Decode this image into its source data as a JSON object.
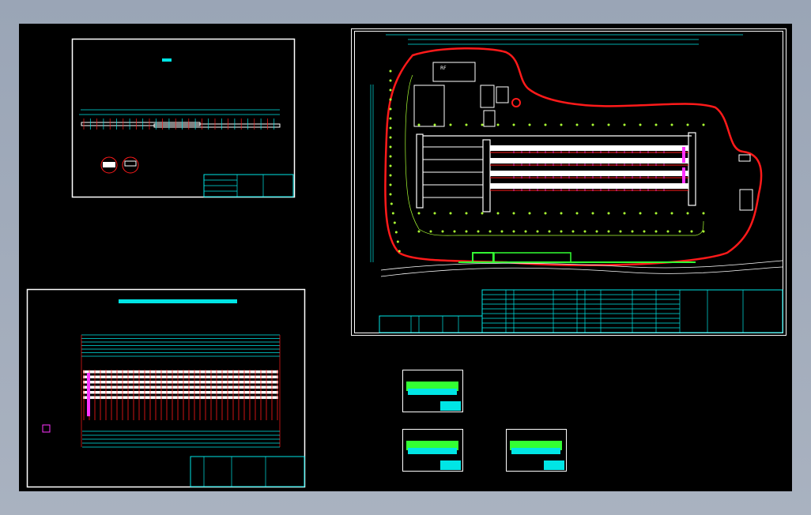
{
  "viewer": {
    "frame_color": "#a0aab8",
    "canvas_color": "#000000"
  },
  "colors": {
    "sheet_border": "#ffffff",
    "annotation": "#00e5e5",
    "boundary": "#ff1a1a",
    "greenery": "#33ff33",
    "lines": "#ffffff",
    "highlight": "#ff33ff",
    "trees": "#aaff33"
  },
  "main_sheet": {
    "building_label": "RF"
  },
  "sheets": [
    {
      "id": "sheet-elevation"
    },
    {
      "id": "sheet-site-plan"
    },
    {
      "id": "sheet-layout-plan"
    },
    {
      "id": "thumbnail-1"
    },
    {
      "id": "thumbnail-2"
    },
    {
      "id": "thumbnail-3"
    }
  ]
}
